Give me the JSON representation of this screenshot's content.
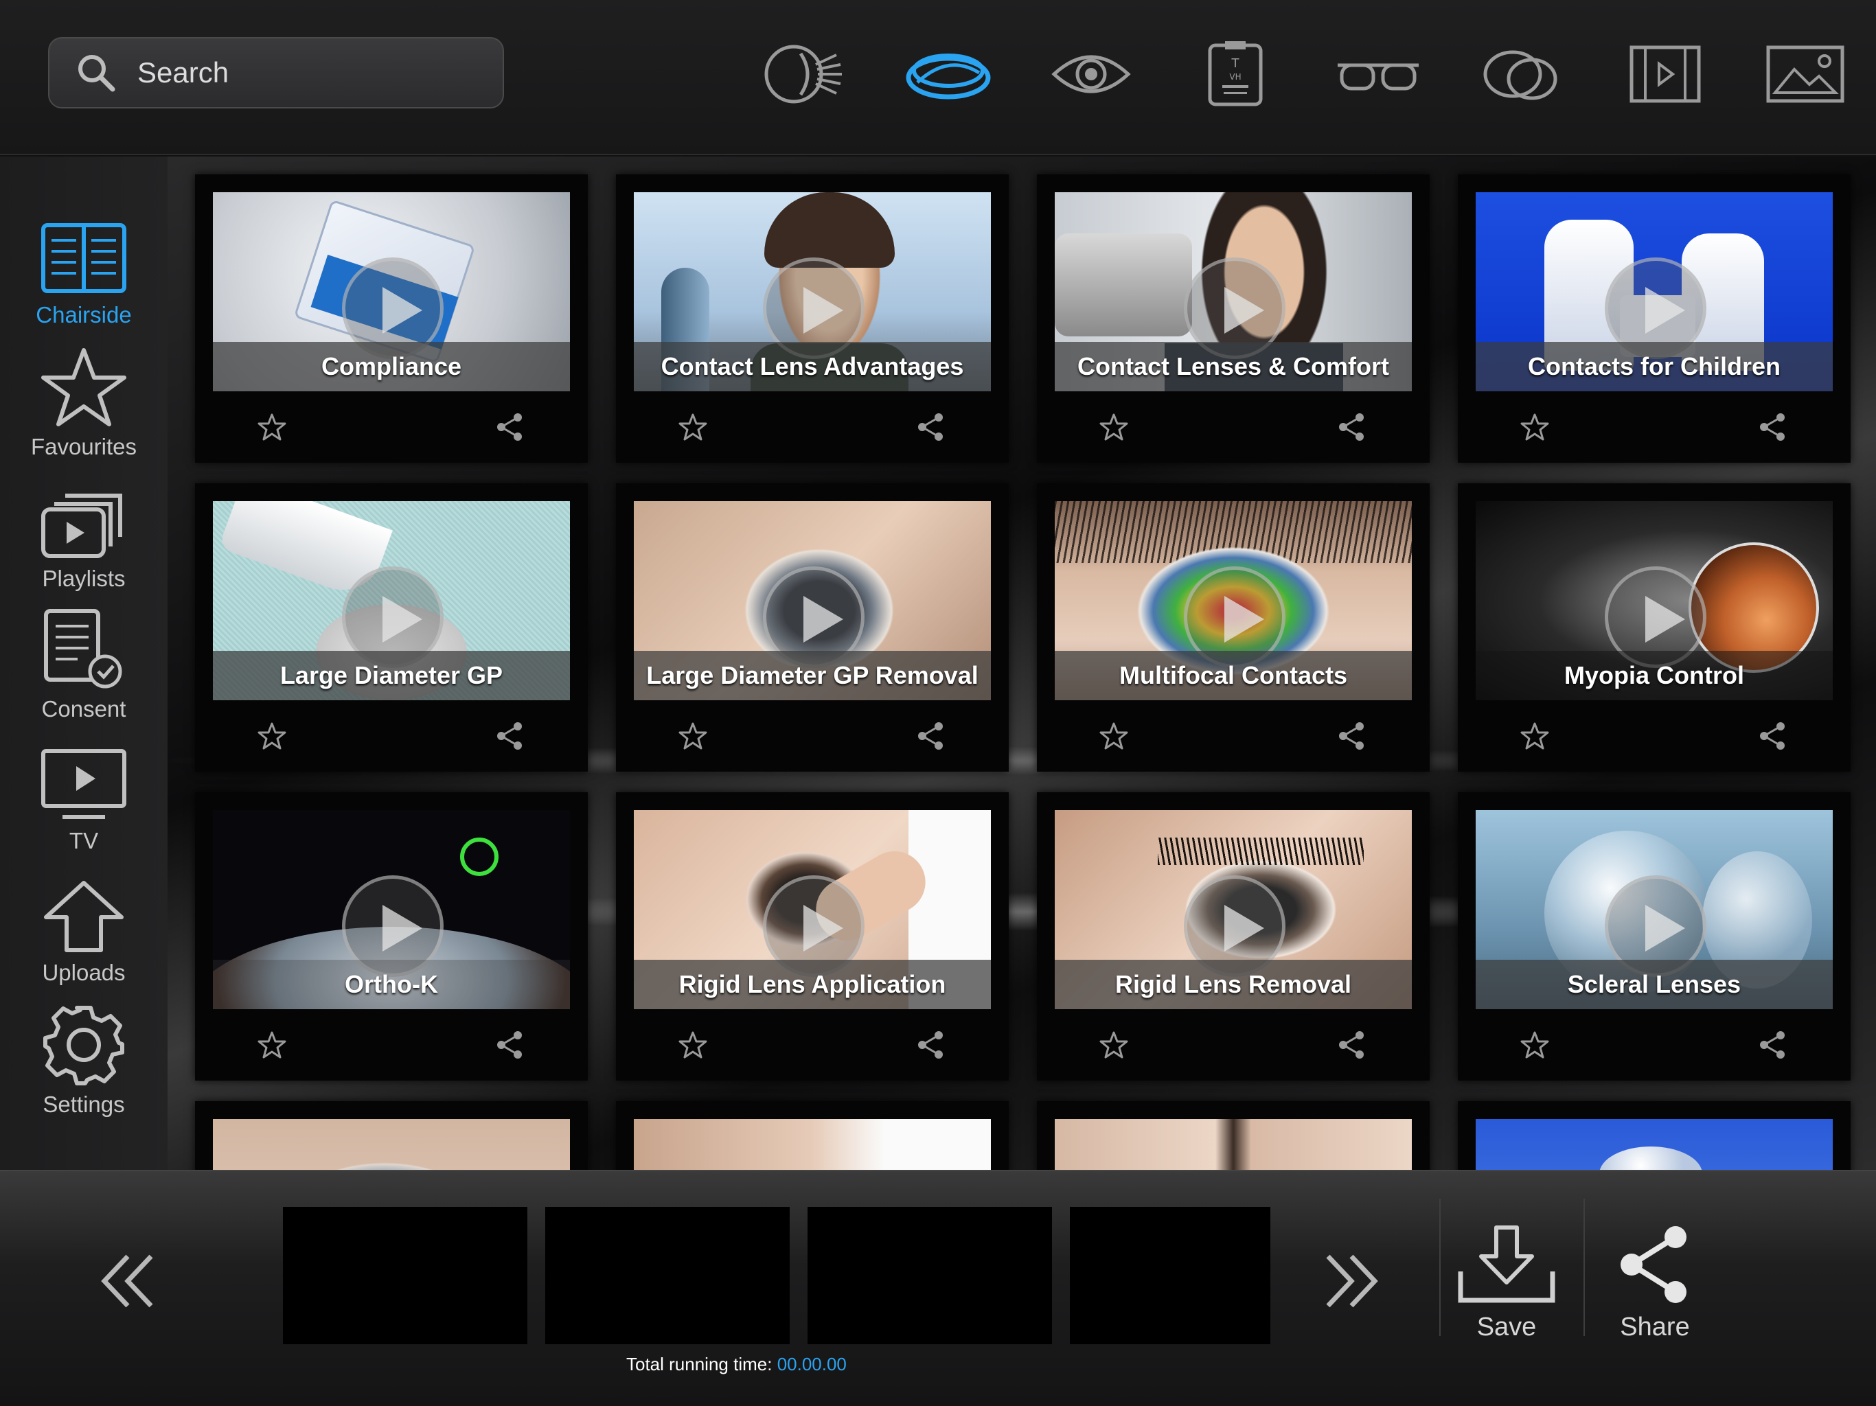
{
  "search": {
    "placeholder": "Search"
  },
  "top_icons": [
    "eye-light-icon",
    "contact-lens-icon",
    "eye-icon",
    "eye-chart-icon",
    "glasses-icon",
    "lenses-icon",
    "video-icon",
    "image-icon"
  ],
  "top_active": "contact-lens-icon",
  "accent_color": "#2aa3f0",
  "sidebar": {
    "items": [
      {
        "label": "Chairside",
        "icon": "book-icon",
        "active": true
      },
      {
        "label": "Favourites",
        "icon": "star-icon"
      },
      {
        "label": "Playlists",
        "icon": "playlists-icon"
      },
      {
        "label": "Consent",
        "icon": "consent-icon"
      },
      {
        "label": "TV",
        "icon": "tv-icon"
      },
      {
        "label": "Uploads",
        "icon": "upload-icon"
      },
      {
        "label": "Settings",
        "icon": "gear-icon"
      }
    ]
  },
  "videos": [
    {
      "title": "Compliance"
    },
    {
      "title": "Contact Lens Advantages"
    },
    {
      "title": "Contact Lenses & Comfort"
    },
    {
      "title": "Contacts for Children"
    },
    {
      "title": "Large Diameter GP"
    },
    {
      "title": "Large Diameter GP Removal"
    },
    {
      "title": "Multifocal Contacts"
    },
    {
      "title": "Myopia Control"
    },
    {
      "title": "Ortho-K"
    },
    {
      "title": "Rigid Lens Application"
    },
    {
      "title": "Rigid Lens Removal"
    },
    {
      "title": "Scleral Lenses"
    }
  ],
  "bottom": {
    "runtime_label": "Total running time:",
    "runtime_value": "00.00.00",
    "save_label": "Save",
    "share_label": "Share"
  }
}
